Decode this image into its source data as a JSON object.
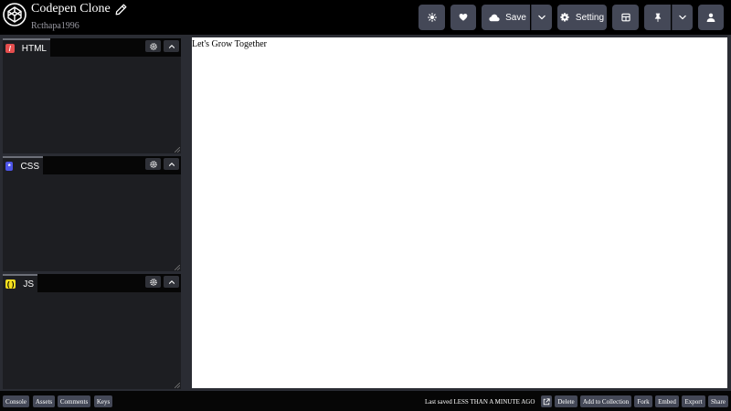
{
  "header": {
    "title": "Codepen Clone",
    "subtitle": "Rcthapa1996",
    "buttons": {
      "theme_icon": "gear-sun-icon",
      "like_icon": "heart-icon",
      "save_label": "Save",
      "setting_label": "Setting"
    }
  },
  "editors": [
    {
      "label": "HTML",
      "icon": "/",
      "icon_bg": "#e44d4d",
      "icon_fg": "#ffffff"
    },
    {
      "label": "CSS",
      "icon": "*",
      "icon_bg": "#4d55e8",
      "icon_fg": "#ffffff"
    },
    {
      "label": "JS",
      "icon": "( )",
      "icon_bg": "#f7df1e",
      "icon_fg": "#000000"
    }
  ],
  "preview": {
    "text": "Let's Grow Together"
  },
  "footer": {
    "left_buttons": [
      "Console",
      "Assets",
      "Comments",
      "Keys"
    ],
    "status": "Last saved LESS THAN A MINUTE AGO",
    "right_buttons": [
      "Delete",
      "Add to Collection",
      "Fork",
      "Embed",
      "Export",
      "Share"
    ]
  },
  "colors": {
    "button_bg": "#444857",
    "editor_bg": "#1d1e22",
    "frame_bg": "#2a2c33"
  }
}
